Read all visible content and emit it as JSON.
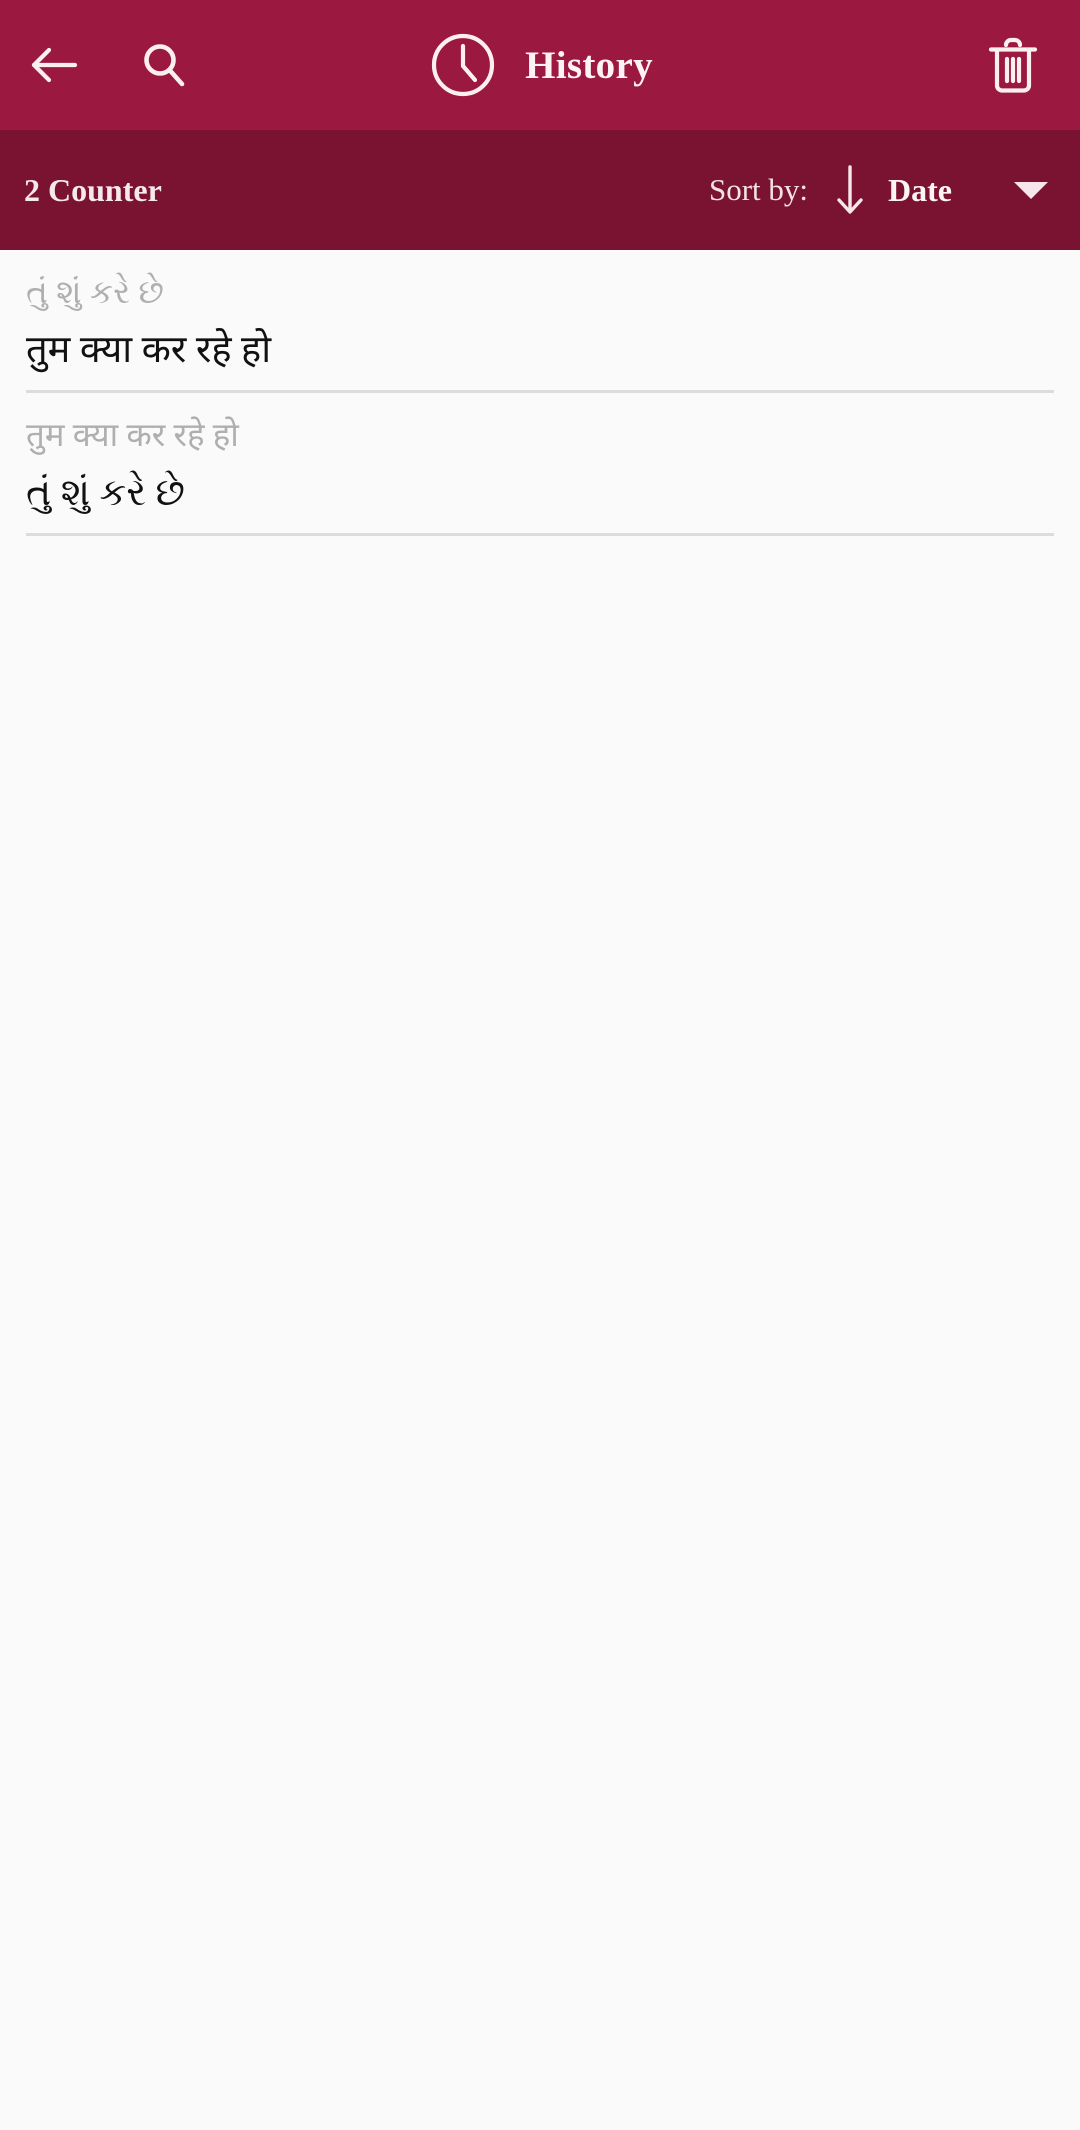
{
  "appbar": {
    "back_icon": "back-arrow-icon",
    "search_icon": "search-icon",
    "clock_icon": "clock-icon",
    "title": "History",
    "delete_icon": "trash-icon",
    "background_color": "#9B1840",
    "foreground_color": "#FDF2F5"
  },
  "sortbar": {
    "counter_label": "2 Counter",
    "sort_by_label": "Sort by:",
    "sort_direction_icon": "arrow-down-icon",
    "sort_value": "Date",
    "dropdown_icon": "chevron-down-icon",
    "background_color": "#7A1232"
  },
  "history": {
    "items": [
      {
        "source_text": "તું શું કરે છે",
        "target_text": "तुम क्या कर रहे हो"
      },
      {
        "source_text": "तुम क्या कर रहे हो",
        "target_text": "તું શું કરે છે"
      }
    ]
  },
  "colors": {
    "page_background": "#FAFAFA",
    "divider": "#DCDCDC",
    "source_text": "#AFAFAF",
    "target_text": "#111111"
  }
}
